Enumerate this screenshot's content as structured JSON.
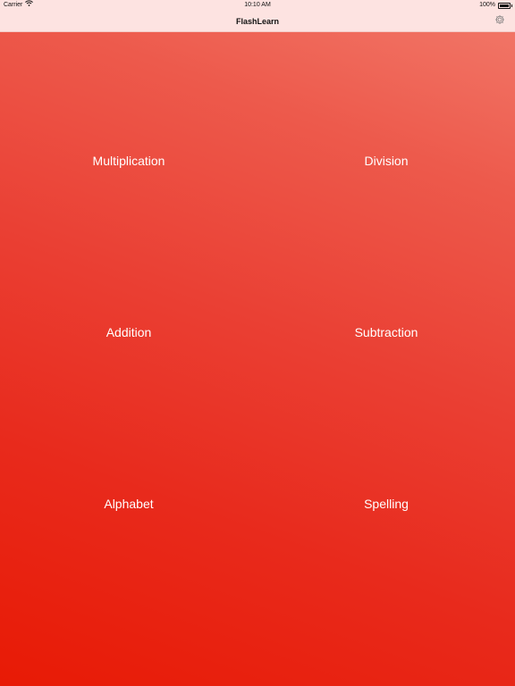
{
  "status_bar": {
    "carrier": "Carrier",
    "time": "10:10 AM",
    "battery_percent": "100%",
    "battery_level": 1.0
  },
  "nav": {
    "title": "FlashLearn",
    "settings_icon": "gear-icon"
  },
  "categories": [
    {
      "label": "Multiplication"
    },
    {
      "label": "Division"
    },
    {
      "label": "Addition"
    },
    {
      "label": "Subtraction"
    },
    {
      "label": "Alphabet"
    },
    {
      "label": "Spelling"
    }
  ],
  "colors": {
    "nav_background": "#fde3e1",
    "gradient_top": "#f27a6b",
    "gradient_bottom": "#e81a05",
    "label_text": "#ffffff"
  }
}
